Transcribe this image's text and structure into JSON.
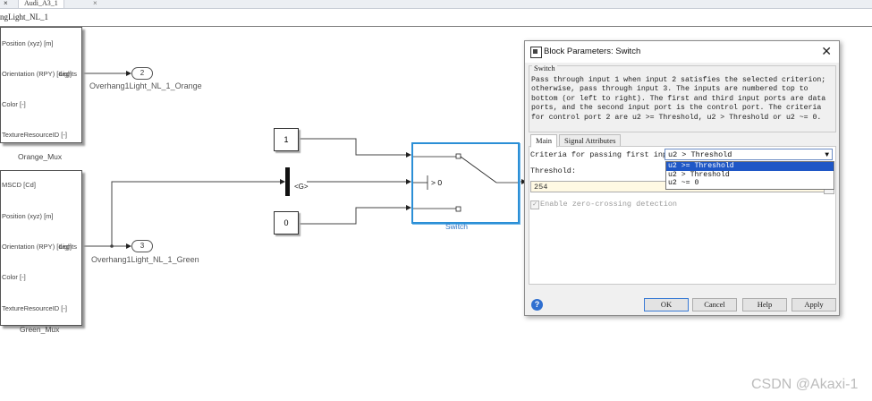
{
  "tabs": {
    "close_glyph_left": "×",
    "model_tab": "Audi_A3_1",
    "close_glyph_right": "×"
  },
  "pathbar": {
    "path": "ngLight_NL_1"
  },
  "orange_mux": {
    "inputs": [
      "Position (xyz) [m]",
      "Orientation (RPY) [deg]",
      "Color [-]",
      "TextureResourceID [-]"
    ],
    "output_label": "Lights",
    "title": "Orange_Mux"
  },
  "green_mux": {
    "inputs": [
      "MSCD [Cd]",
      "Position (xyz) [m]",
      "Orientation (RPY) [deg]",
      "Color [-]",
      "TextureResourceID [-]"
    ],
    "output_label": "Lights",
    "title": "Green_Mux"
  },
  "ports": {
    "orange": {
      "number": "2",
      "name": "Overhang1Light_NL_1_Orange"
    },
    "green": {
      "number": "3",
      "name": "Overhang1Light_NL_1_Green"
    }
  },
  "constants": {
    "top": "1",
    "bottom": "0"
  },
  "goto_tag": "<G>",
  "switch": {
    "criterion_glyph": "> 0",
    "name": "Switch"
  },
  "watermark": "CSDN @Akaxi-1",
  "dialog": {
    "title": "Block Parameters: Switch",
    "close_glyph": "✕",
    "group_title": "Switch",
    "description": "Pass through input 1 when input 2 satisfies the selected criterion; otherwise, pass through input 3. The inputs are numbered top to bottom (or left to right). The first and third input ports are data ports, and the second input port is the control port. The criteria for control port 2 are u2 >= Threshold, u2 > Threshold or u2 ~= 0.",
    "tabs": [
      "Main",
      "Signal Attributes"
    ],
    "criteria_label": "Criteria for passing first input:",
    "criteria_value": "u2 > Threshold",
    "criteria_options": [
      "u2 >= Threshold",
      "u2 > Threshold",
      "u2 ~= 0"
    ],
    "criteria_highlighted": "u2 >= Threshold",
    "threshold_label": "Threshold:",
    "threshold_value": "254",
    "zero_crossing_label": "Enable zero-crossing detection",
    "zero_crossing_checked": true,
    "buttons": {
      "ok": "OK",
      "cancel": "Cancel",
      "help": "Help",
      "apply": "Apply"
    }
  },
  "colors": {
    "selection": "#1f57c6",
    "switch_border": "#2b8fd6",
    "threshold_bg": "#fff9e3"
  }
}
